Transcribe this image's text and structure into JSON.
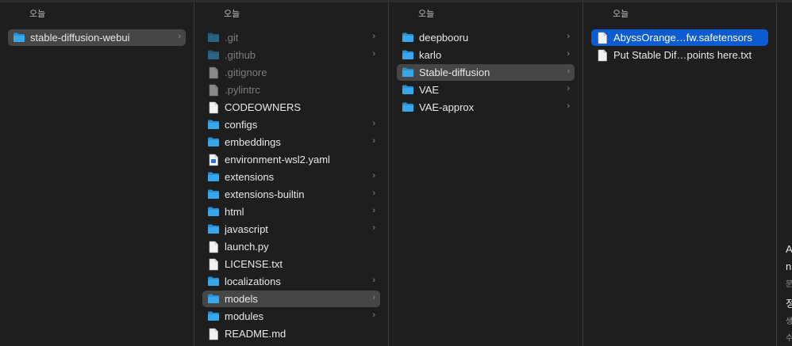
{
  "columns": [
    {
      "header": "오늘",
      "items": [
        {
          "label": "stable-diffusion-webui",
          "kind": "folder",
          "chevron": true,
          "state": "grey"
        }
      ]
    },
    {
      "header": "오늘",
      "items": [
        {
          "label": ".git",
          "kind": "folder",
          "chevron": true,
          "dim": true
        },
        {
          "label": ".github",
          "kind": "folder",
          "chevron": true,
          "dim": true
        },
        {
          "label": ".gitignore",
          "kind": "file",
          "dim": true
        },
        {
          "label": ".pylintrc",
          "kind": "file",
          "dim": true
        },
        {
          "label": "CODEOWNERS",
          "kind": "file"
        },
        {
          "label": "configs",
          "kind": "folder",
          "chevron": true
        },
        {
          "label": "embeddings",
          "kind": "folder",
          "chevron": true
        },
        {
          "label": "environment-wsl2.yaml",
          "kind": "yaml"
        },
        {
          "label": "extensions",
          "kind": "folder",
          "chevron": true
        },
        {
          "label": "extensions-builtin",
          "kind": "folder",
          "chevron": true
        },
        {
          "label": "html",
          "kind": "folder",
          "chevron": true
        },
        {
          "label": "javascript",
          "kind": "folder",
          "chevron": true
        },
        {
          "label": "launch.py",
          "kind": "file"
        },
        {
          "label": "LICENSE.txt",
          "kind": "file"
        },
        {
          "label": "localizations",
          "kind": "folder",
          "chevron": true
        },
        {
          "label": "models",
          "kind": "folder",
          "chevron": true,
          "state": "grey"
        },
        {
          "label": "modules",
          "kind": "folder",
          "chevron": true
        },
        {
          "label": "README.md",
          "kind": "file"
        }
      ]
    },
    {
      "header": "오늘",
      "items": [
        {
          "label": "deepbooru",
          "kind": "folder",
          "chevron": true
        },
        {
          "label": "karlo",
          "kind": "folder",
          "chevron": true
        },
        {
          "label": "Stable-diffusion",
          "kind": "folder",
          "chevron": true,
          "state": "grey"
        },
        {
          "label": "VAE",
          "kind": "folder",
          "chevron": true
        },
        {
          "label": "VAE-approx",
          "kind": "folder",
          "chevron": true
        }
      ]
    },
    {
      "header": "오늘",
      "items": [
        {
          "label": "AbyssOrange…fw.safetensors",
          "kind": "file",
          "state": "blue"
        },
        {
          "label": "Put Stable Dif…points here.txt",
          "kind": "file"
        }
      ]
    }
  ],
  "preview_peek": [
    "A",
    "n",
    "문",
    "정",
    "생",
    "수"
  ],
  "colors": {
    "folder": "#39a7ec",
    "folder_tab": "#2a8fd3",
    "selection_blue": "#0b5bd2",
    "selection_grey": "#464646"
  }
}
